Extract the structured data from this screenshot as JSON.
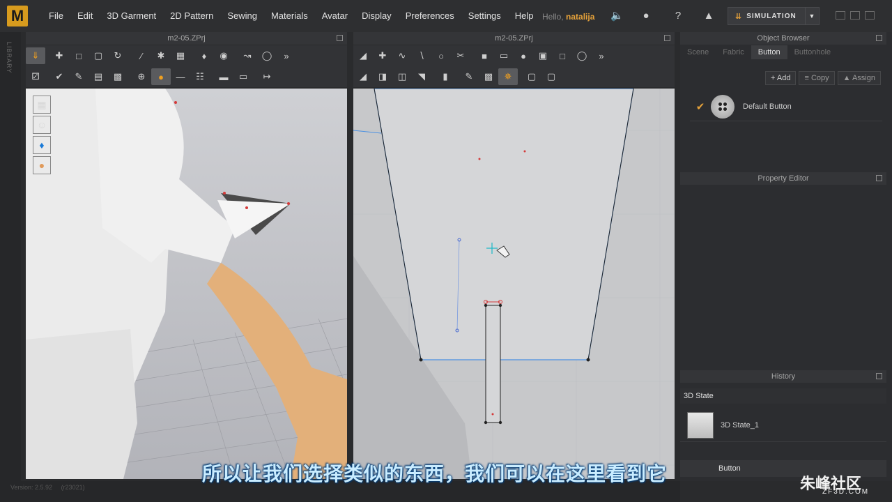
{
  "app": {
    "logo": "M",
    "menu": [
      "File",
      "Edit",
      "3D Garment",
      "2D Pattern",
      "Sewing",
      "Materials",
      "Avatar",
      "Display",
      "Preferences",
      "Settings",
      "Help"
    ],
    "hello_prefix": "Hello,",
    "user": "natalija",
    "simulation_label": "SIMULATION"
  },
  "library": {
    "label": "LIBRARY"
  },
  "panels": {
    "left_title": "m2-05.ZPrj",
    "right_title": "m2-05.ZPrj"
  },
  "object_browser": {
    "title": "Object Browser",
    "tabs": [
      "Scene",
      "Fabric",
      "Button",
      "Buttonhole"
    ],
    "active_tab": "Button",
    "actions": {
      "add": "Add",
      "copy": "Copy",
      "assign": "Assign"
    },
    "items": [
      {
        "label": "Default Button"
      }
    ]
  },
  "property_editor": {
    "title": "Property Editor"
  },
  "history": {
    "title": "History",
    "state_label": "3D State",
    "items": [
      {
        "label": "3D State_1"
      }
    ]
  },
  "bottom_item": {
    "label": "Button"
  },
  "status": {
    "version": "Version: 2.5.92",
    "build": "(r23021)"
  },
  "overlay": {
    "subtitle": "所以让我们选择类似的东西，我们可以在这里看到它",
    "watermark": "朱峰社区",
    "watermark_sub": "ZF3D.COM"
  },
  "colors": {
    "accent": "#e6a23a",
    "pattern_outline": "#4a90e2"
  }
}
